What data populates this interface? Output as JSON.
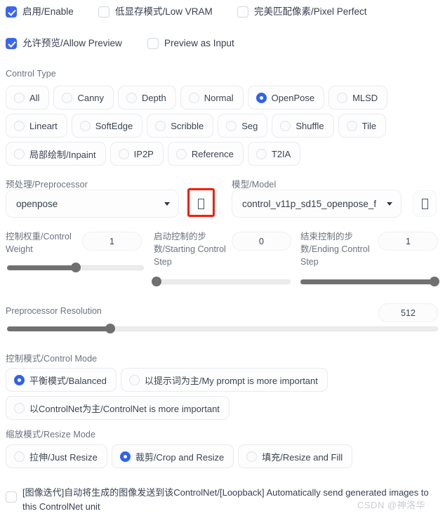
{
  "top_checkboxes": [
    {
      "label": "启用/Enable",
      "checked": true
    },
    {
      "label": "低显存模式/Low VRAM",
      "checked": false
    },
    {
      "label": "完美匹配像素/Pixel Perfect",
      "checked": false
    },
    {
      "label": "允许预览/Allow Preview",
      "checked": true
    },
    {
      "label": "Preview as Input",
      "checked": false
    }
  ],
  "control_type": {
    "label": "Control Type",
    "selected": "OpenPose",
    "options": [
      "All",
      "Canny",
      "Depth",
      "Normal",
      "OpenPose",
      "MLSD",
      "Lineart",
      "SoftEdge",
      "Scribble",
      "Seg",
      "Shuffle",
      "Tile",
      "局部绘制/Inpaint",
      "IP2P",
      "Reference",
      "T2IA"
    ]
  },
  "preprocessor": {
    "label": "预处理/Preprocessor",
    "value": "openpose",
    "refresh_icon": "explosion-icon"
  },
  "model": {
    "label": "模型/Model",
    "value": "control_v11p_sd15_openpose_f",
    "refresh_icon": "refresh-icon"
  },
  "sliders": [
    {
      "label": "控制权重/Control Weight",
      "value": "1",
      "percent": 50
    },
    {
      "label": "启动控制的步数/Starting Control Step",
      "value": "0",
      "percent": 0
    },
    {
      "label": "结束控制的步数/Ending Control Step",
      "value": "1",
      "percent": 100
    }
  ],
  "preprocessor_resolution": {
    "label": "Preprocessor Resolution",
    "value": "512",
    "percent": 24
  },
  "control_mode": {
    "label": "控制模式/Control Mode",
    "selected": "平衡模式/Balanced",
    "options": [
      "平衡模式/Balanced",
      "以提示词为主/My prompt is more important",
      "以ControlNet为主/ControlNet is more important"
    ]
  },
  "resize_mode": {
    "label": "缩放模式/Resize Mode",
    "selected": "裁剪/Crop and Resize",
    "options": [
      "拉伸/Just Resize",
      "裁剪/Crop and Resize",
      "填充/Resize and Fill"
    ]
  },
  "loopback": {
    "label": "[图像迭代]自动将生成的图像发送到该ControlNet/[Loopback] Automatically send generated images to this ControlNet unit",
    "checked": false
  },
  "watermark": "CSDN @神洛华",
  "colors": {
    "accent": "#2f62ed",
    "checkbox": "#3b67ec",
    "slider": "#707070",
    "highlight": "#fb1b07"
  }
}
